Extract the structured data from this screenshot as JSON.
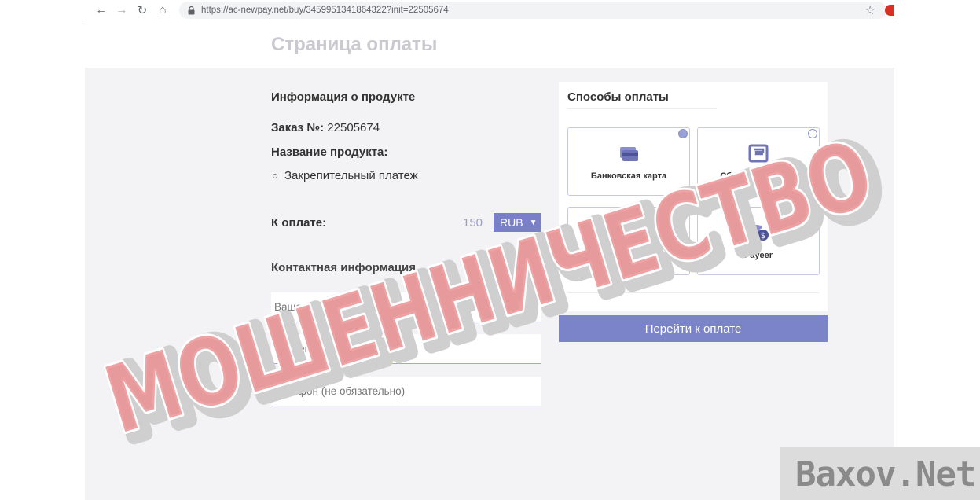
{
  "browser": {
    "url": "https://ac-newpay.net/buy/3459951341864322?init=22505674"
  },
  "page": {
    "title": "Страница оплаты"
  },
  "product": {
    "section_title": "Информация о продукте",
    "order_label": "Заказ №:",
    "order_number": "22505674",
    "name_label": "Название продукта:",
    "item": "Закрепительный платеж",
    "to_pay_label": "К оплате:",
    "amount": "150",
    "currency": "RUB"
  },
  "contact": {
    "section_title": "Контактная информация",
    "name_placeholder": "Ваше имя",
    "email_placeholder": "Ваш email",
    "phone_placeholder": "Телефон (не обязательно)"
  },
  "payment": {
    "title": "Способы оплаты",
    "methods": [
      {
        "label": "Банковская карта",
        "icon": "bank-card-icon",
        "selected": true
      },
      {
        "label": "Сбербанк Онлайн",
        "icon": "sberbank-icon",
        "selected": false
      },
      {
        "label": "Криптовалюты",
        "icon": "crypto-wallet-icon",
        "selected": false
      },
      {
        "label": "Payeer",
        "icon": "coins-icon",
        "selected": false
      }
    ],
    "button_label": "Перейти к оплате"
  },
  "overlay": {
    "stamp_text": "МОШЕННИЧЕСТВО",
    "watermark": "Baxov.Net"
  },
  "colors": {
    "accent": "#7b84c9",
    "stamp": "#e88a8c",
    "background": "#f3f3f5"
  }
}
